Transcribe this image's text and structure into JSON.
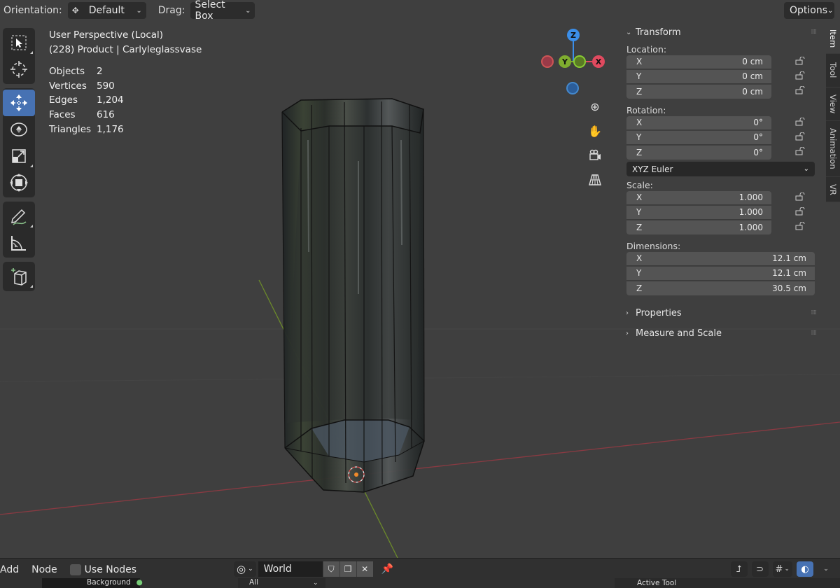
{
  "header": {
    "orientation_label": "Orientation:",
    "orientation_value": "Default",
    "drag_label": "Drag:",
    "drag_value": "Select Box",
    "options_label": "Options"
  },
  "toolbar": {
    "tools": [
      {
        "name": "select-box-tool",
        "icon": "select-box-icon",
        "active": false
      },
      {
        "name": "cursor-tool",
        "icon": "cursor-icon",
        "active": false
      },
      {
        "name": "move-tool",
        "icon": "move-icon",
        "active": true
      },
      {
        "name": "rotate-tool",
        "icon": "rotate-icon",
        "active": false
      },
      {
        "name": "scale-tool",
        "icon": "scale-icon",
        "active": false
      },
      {
        "name": "transform-tool",
        "icon": "transform-icon",
        "active": false
      },
      {
        "name": "annotate-tool",
        "icon": "annotate-icon",
        "active": false
      },
      {
        "name": "measure-tool",
        "icon": "measure-icon",
        "active": false
      },
      {
        "name": "add-cube-tool",
        "icon": "add-cube-icon",
        "active": false
      }
    ]
  },
  "overlay": {
    "view_name": "User Perspective (Local)",
    "object_info": "(228) Product | Carlyleglassvase",
    "stats": [
      {
        "key": "Objects",
        "value": "2"
      },
      {
        "key": "Vertices",
        "value": "590"
      },
      {
        "key": "Edges",
        "value": "1,204"
      },
      {
        "key": "Faces",
        "value": "616"
      },
      {
        "key": "Triangles",
        "value": "1,176"
      }
    ]
  },
  "gizmo": {
    "z_label": "Z",
    "y_label": "Y",
    "x_label": "X",
    "colors": {
      "x": "#e04a5f",
      "y": "#7fad2f",
      "z": "#3b8ee8"
    }
  },
  "npanel": {
    "transform_title": "Transform",
    "location_label": "Location:",
    "location": [
      {
        "axis": "X",
        "value": "0 cm"
      },
      {
        "axis": "Y",
        "value": "0 cm"
      },
      {
        "axis": "Z",
        "value": "0 cm"
      }
    ],
    "rotation_label": "Rotation:",
    "rotation": [
      {
        "axis": "X",
        "value": "0°"
      },
      {
        "axis": "Y",
        "value": "0°"
      },
      {
        "axis": "Z",
        "value": "0°"
      }
    ],
    "rotation_mode": "XYZ Euler",
    "scale_label": "Scale:",
    "scale": [
      {
        "axis": "X",
        "value": "1.000"
      },
      {
        "axis": "Y",
        "value": "1.000"
      },
      {
        "axis": "Z",
        "value": "1.000"
      }
    ],
    "dimensions_label": "Dimensions:",
    "dimensions": [
      {
        "axis": "X",
        "value": "12.1 cm"
      },
      {
        "axis": "Y",
        "value": "12.1 cm"
      },
      {
        "axis": "Z",
        "value": "30.5 cm"
      }
    ],
    "properties_title": "Properties",
    "measure_title": "Measure and Scale"
  },
  "vtabs": [
    {
      "label": "Item",
      "active": true
    },
    {
      "label": "Tool",
      "active": false
    },
    {
      "label": "View",
      "active": false
    },
    {
      "label": "Animation",
      "active": false
    },
    {
      "label": "VR",
      "active": false
    }
  ],
  "bottombar": {
    "add_label": "Add",
    "node_label": "Node",
    "use_nodes_label": "Use Nodes",
    "world_name": "World",
    "background_node": "Background",
    "all_label": "All",
    "active_tool": "Active Tool"
  },
  "colors": {
    "accent": "#4772b3",
    "viewport_bg": "#3f3f3f",
    "panel_field": "#545454"
  }
}
